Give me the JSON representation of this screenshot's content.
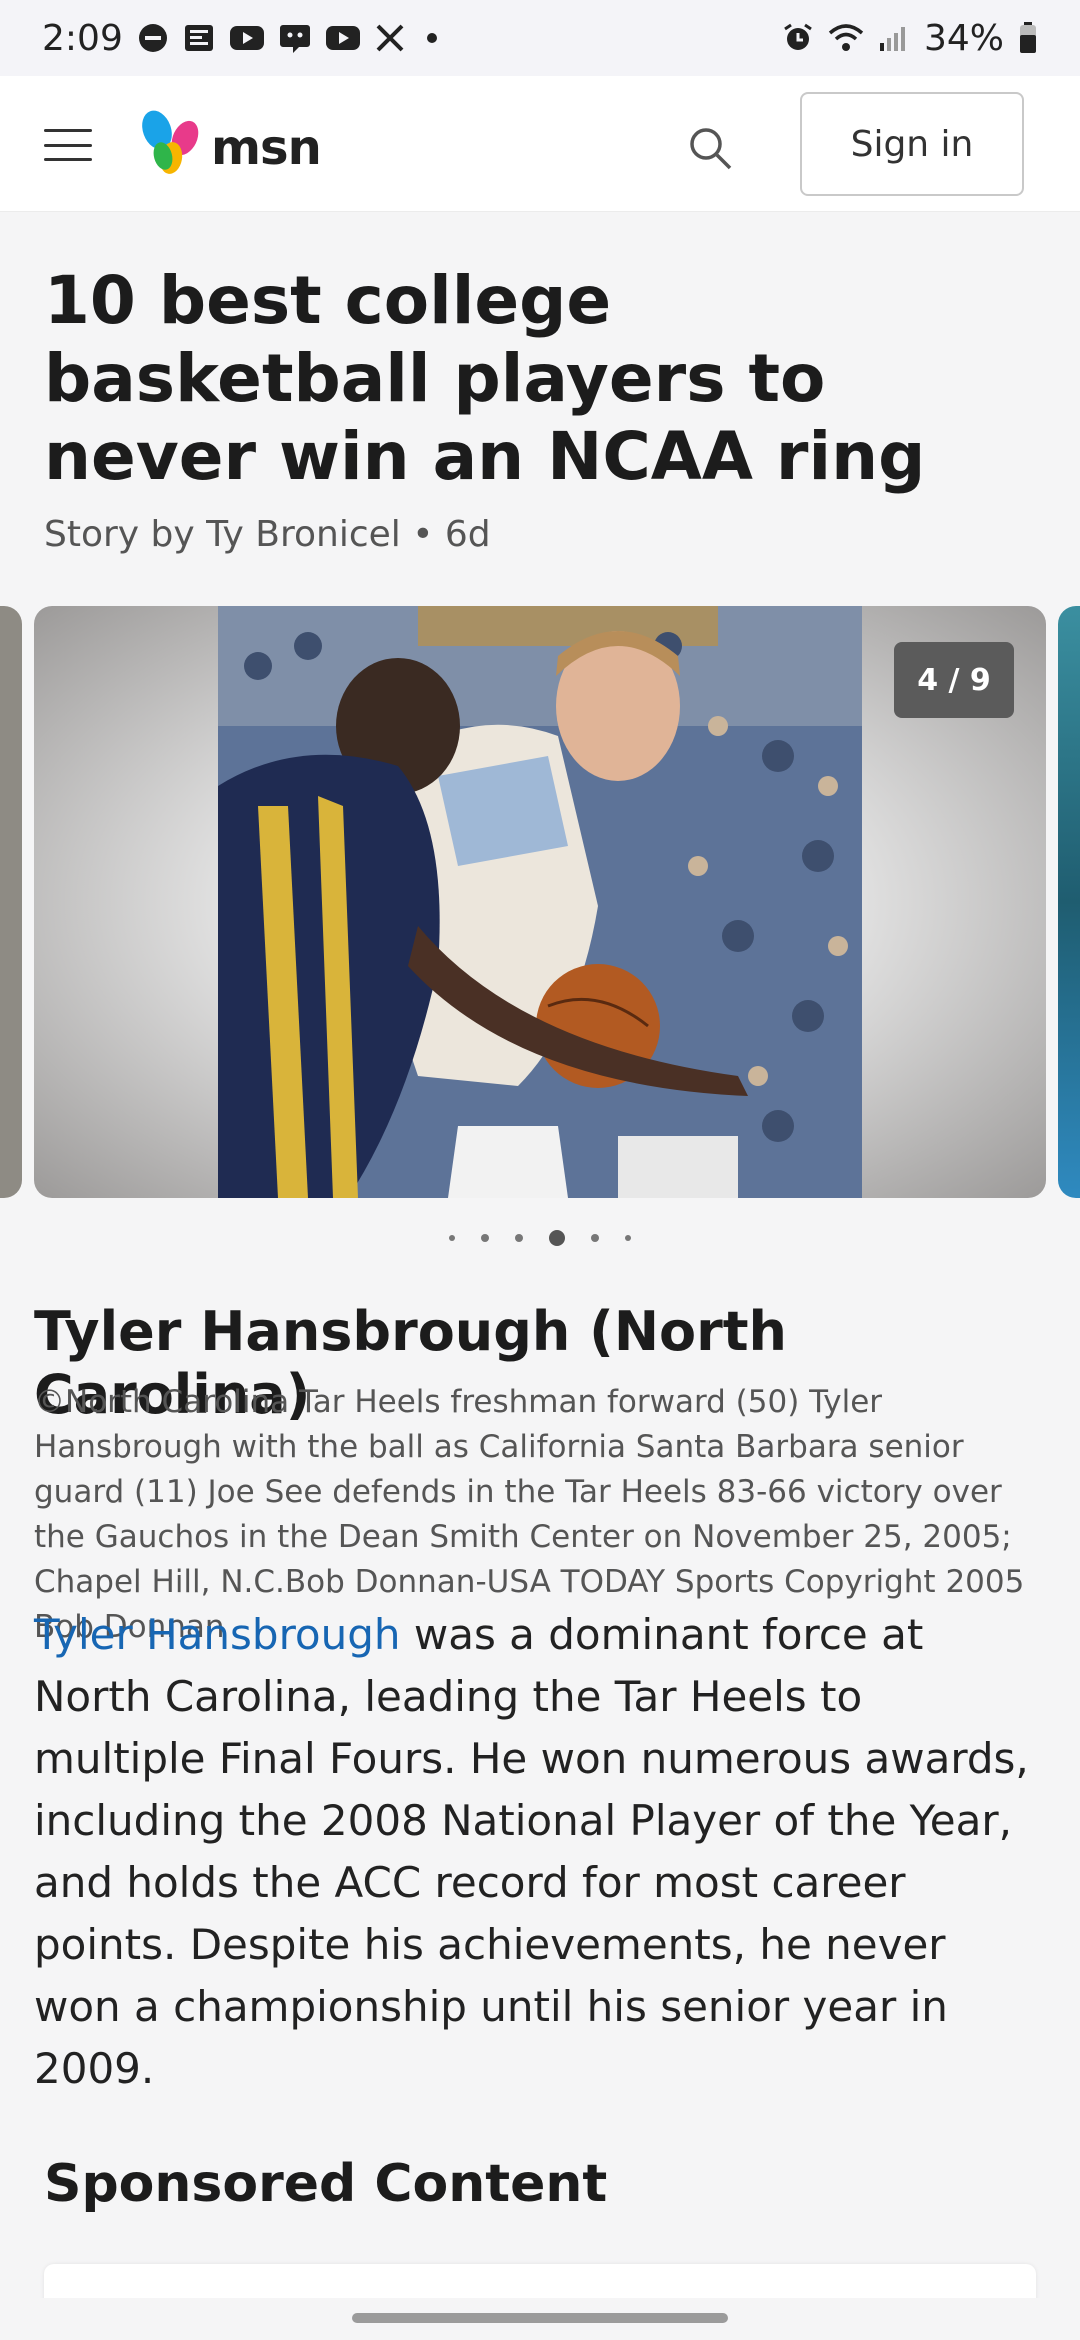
{
  "status_bar": {
    "time": "2:09",
    "battery": "34%",
    "icons": [
      "dnd-icon",
      "news-icon",
      "youtube-icon",
      "mastodon-icon",
      "youtube-icon",
      "x-icon",
      "dot-icon",
      "alarm-icon",
      "wifi-icon",
      "signal-icon",
      "battery-icon"
    ]
  },
  "header": {
    "logo_text": "msn",
    "sign_in_label": "Sign in"
  },
  "article": {
    "title": "10 best college basketball players to never win an NCAA ring",
    "byline": "Story by Ty Bronicel • 6d"
  },
  "carousel": {
    "counter": "4 / 9",
    "current_index": 4,
    "dot_count": 6
  },
  "slide": {
    "title": "Tyler Hansbrough (North Carolina)",
    "caption": "©North Carolina Tar Heels freshman forward (50) Tyler Hansbrough with the ball as California Santa Barbara senior guard (11) Joe See defends in the Tar Heels 83-66 victory over the Gauchos in the Dean Smith Center on November 25, 2005; Chapel Hill, N.C.Bob Donnan-USA TODAY Sports Copyright 2005 Bob Donnan",
    "body_link": "Tyler Hansbrough",
    "body_rest": " was a dominant force at North Carolina, leading the Tar Heels to multiple Final Fours. He won numerous awards, including the 2008 National Player of the Year, and holds the ACC record for most career points. Despite his achievements, he never won a championship until his senior year in 2009."
  },
  "sponsored": {
    "heading": "Sponsored Content"
  },
  "colors": {
    "link": "#1766b3",
    "background": "#f5f5f6"
  }
}
